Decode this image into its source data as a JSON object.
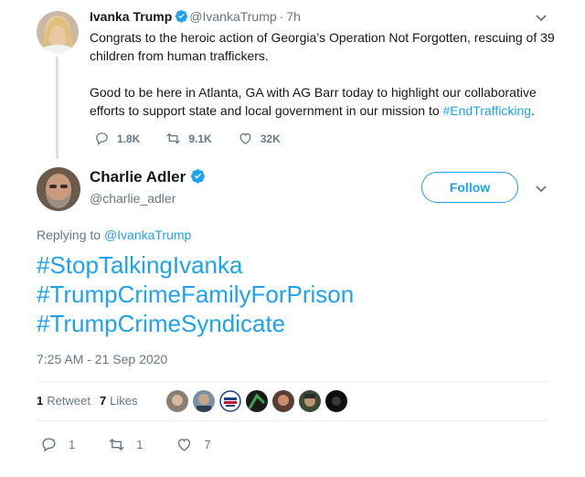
{
  "parent_tweet": {
    "name": "Ivanka Trump",
    "handle": "@IvankaTrump",
    "separator": "·",
    "time": "7h",
    "paragraph1": "Congrats to the heroic action of Georgia’s Operation Not Forgotten, rescuing of 39 children from human traffickers.",
    "paragraph2_text": "Good to be here in Atlanta, GA with AG Barr today to highlight our collaborative efforts to support state and local government in our mission to ",
    "paragraph2_hashtag": "#EndTrafficking",
    "paragraph2_end": ".",
    "replies": "1.8K",
    "retweets": "9.1K",
    "likes": "32K"
  },
  "main_tweet": {
    "name": "Charlie Adler",
    "handle": "@charlie_adler",
    "follow_label": "Follow",
    "replying_label": "Replying to",
    "replying_handle": "@IvankaTrump",
    "lines": [
      "#StopTalkingIvanka",
      "#TrumpCrimeFamilyForPrison",
      "#TrumpCrimeSyndicate"
    ],
    "timestamp": "7:25 AM - 21 Sep 2020",
    "retweet_count": "1",
    "retweet_label": "Retweet",
    "like_count": "7",
    "like_label": "Likes",
    "reply_count": "1",
    "retweets_action_count": "1",
    "likes_action_count": "7"
  },
  "icons": {
    "verified": "verified-badge-icon",
    "caret": "chevron-down-icon",
    "reply": "reply-icon",
    "retweet": "retweet-icon",
    "like": "heart-icon"
  },
  "colors": {
    "accent": "#1da1f2",
    "muted": "#657786",
    "thread_line": "#cfe3f5",
    "separator": "#e6ecf0"
  }
}
